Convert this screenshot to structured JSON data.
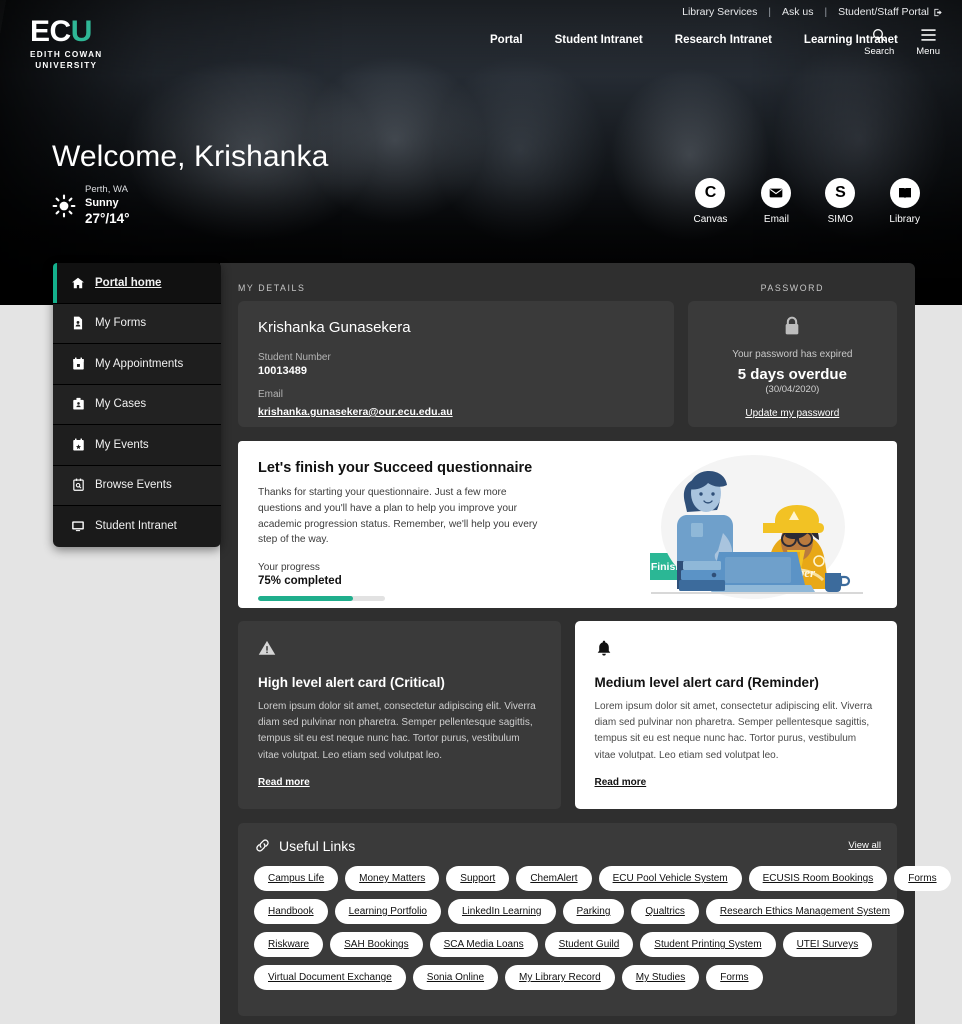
{
  "brand": {
    "logo_text": "ECU",
    "logo_line1": "EDITH COWAN",
    "logo_line2": "UNIVERSITY",
    "accent_color": "#2bb795"
  },
  "utility_bar": {
    "links": [
      {
        "label": "Library Services"
      },
      {
        "label": "Ask us"
      },
      {
        "label": "Student/Staff Portal"
      }
    ],
    "separator": "|"
  },
  "main_nav": {
    "items": [
      {
        "label": "Portal"
      },
      {
        "label": "Student Intranet"
      },
      {
        "label": "Research Intranet"
      },
      {
        "label": "Learning Intranet"
      }
    ],
    "tools": [
      {
        "label": "Search",
        "icon": "search-icon"
      },
      {
        "label": "Menu",
        "icon": "hamburger-menu-icon"
      }
    ]
  },
  "hero": {
    "welcome": "Welcome, Krishanka",
    "weather": {
      "icon": "sun-icon",
      "location": "Perth, WA",
      "condition": "Sunny",
      "temperature": "27°/14°"
    },
    "quick_links": [
      {
        "label": "Canvas",
        "glyph": "C",
        "icon": "canvas-icon"
      },
      {
        "label": "Email",
        "glyph": "",
        "icon": "envelope-icon"
      },
      {
        "label": "SIMO",
        "glyph": "S",
        "icon": "simo-icon"
      },
      {
        "label": "Library",
        "glyph": "",
        "icon": "book-icon"
      }
    ]
  },
  "sidebar": {
    "items": [
      {
        "label": "Portal home",
        "icon": "home-icon",
        "active": true
      },
      {
        "label": "My Forms",
        "icon": "document-icon",
        "active": false
      },
      {
        "label": "My Appointments",
        "icon": "calendar-icon",
        "active": false
      },
      {
        "label": "My Cases",
        "icon": "briefcase-icon",
        "active": false
      },
      {
        "label": "My Events",
        "icon": "calendar-star-icon",
        "active": false
      },
      {
        "label": "Browse Events",
        "icon": "search-calendar-icon",
        "active": false
      },
      {
        "label": "Student Intranet",
        "icon": "monitor-icon",
        "active": false
      }
    ]
  },
  "my_details": {
    "section_label": "MY DETAILS",
    "name": "Krishanka  Gunasekera",
    "student_number_label": "Student Number",
    "student_number": "10013489",
    "email_label": "Email",
    "email": "krishanka.gunasekera@our.ecu.edu.au"
  },
  "password": {
    "section_label": "PASSWORD",
    "icon": "lock-icon",
    "status": "Your password has expired",
    "overdue": "5 days overdue",
    "date": "(30/04/2020)",
    "link": "Update my password"
  },
  "questionnaire": {
    "title": "Let's finish your Succeed questionnaire",
    "body": "Thanks for starting your questionnaire. Just a few more questions and you'll have a plan to help you improve your academic progression status. Remember, we'll help you every step of the way.",
    "progress_label": "Your progress",
    "progress_text": "75% completed",
    "progress_percent": 75,
    "button": "Finish your questionnaire",
    "illustration": "two-students-at-laptop-illustration"
  },
  "alerts": [
    {
      "icon": "warning-triangle-icon",
      "title": "High level alert card (Critical)",
      "body": "Lorem ipsum dolor sit amet, consectetur adipiscing elit. Viverra diam sed pulvinar non pharetra. Semper pellentesque sagittis, tempus sit eu est neque nunc hac. Tortor purus, vestibulum vitae volutpat. Leo etiam sed volutpat leo.",
      "link": "Read more",
      "style": "critical"
    },
    {
      "icon": "bell-icon",
      "title": "Medium level alert card (Reminder)",
      "body": "Lorem ipsum dolor sit amet, consectetur adipiscing elit. Viverra diam sed pulvinar non pharetra. Semper pellentesque sagittis, tempus sit eu est neque nunc hac. Tortor purus, vestibulum vitae volutpat. Leo etiam sed volutpat leo.",
      "link": "Read more",
      "style": "reminder"
    }
  ],
  "useful_links": {
    "icon": "link-chain-icon",
    "title": "Useful Links",
    "view_all": "View all",
    "rows": [
      [
        "Campus Life",
        "Money Matters",
        "Support",
        "ChemAlert",
        "ECU Pool Vehicle System",
        "ECUSIS Room Bookings",
        "Forms"
      ],
      [
        "Handbook",
        "Learning Portfolio",
        "LinkedIn Learning",
        "Parking",
        "Qualtrics",
        "Research Ethics Management System"
      ],
      [
        "Riskware",
        "SAH Bookings",
        "SCA Media Loans",
        "Student Guild",
        "Student Printing System",
        "UTEI Surveys"
      ],
      [
        "Virtual Document Exchange",
        "Sonia Online",
        "My Library Record",
        "My Studies",
        "Forms"
      ]
    ]
  }
}
